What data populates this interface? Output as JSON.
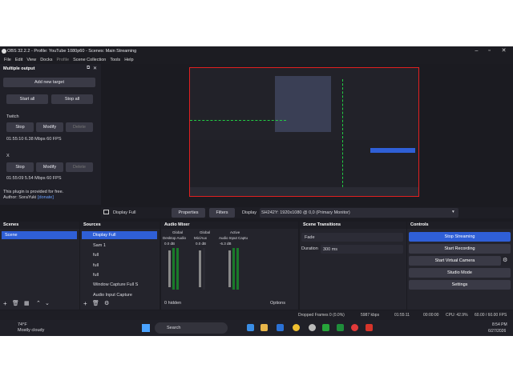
{
  "window": {
    "title": "OBS 32.2.2 - Profile: YouTube 1080p60 - Scenes: Main Streaming"
  },
  "menu": [
    "File",
    "Edit",
    "View",
    "Docks",
    "Profile",
    "Scene Collection",
    "Tools",
    "Help"
  ],
  "multi_output": {
    "title": "Multiple output",
    "add_target": "Add new target",
    "start_all": "Start all",
    "stop_all": "Stop all",
    "targets": [
      {
        "name": "Twitch",
        "stop": "Stop",
        "modify": "Modify",
        "delete": "Delete",
        "stats": "01:55:10  6.38 Mbps  60 FPS"
      },
      {
        "name": "X",
        "stop": "Stop",
        "modify": "Modify",
        "delete": "Delete",
        "stats": "01:55:09  5.54 Mbps  60 FPS"
      }
    ],
    "footer1": "This plugin is provided for free.",
    "footer2": "Author: SoraYuki",
    "footer_link": "[donate]"
  },
  "preview_bar": {
    "source": "Display Full",
    "properties": "Properties",
    "filters": "Filters",
    "display_label": "Display",
    "display_value": "SH242Y: 1920x1080 @ 0,0 (Primary Monitor)"
  },
  "scenes": {
    "title": "Scenes",
    "items": [
      "Scene"
    ]
  },
  "sources": {
    "title": "Sources",
    "items": [
      "Display Full",
      "Sam 1",
      "full",
      "full",
      "full",
      "Window Capture Full S",
      "Audio Input Capture"
    ]
  },
  "mixer": {
    "title": "Audio Mixer",
    "channels": [
      {
        "tag": "Global",
        "name": "Desktop Audio",
        "db": "0.0 dB"
      },
      {
        "tag": "Global",
        "name": "Mic/Aux",
        "db": "0.0 dB"
      },
      {
        "tag": "Active",
        "name": "Audio Input Capture",
        "db": "-6.3 dB"
      }
    ],
    "hidden": "0 hidden",
    "options": "Options"
  },
  "transitions": {
    "title": "Scene Transitions",
    "type": "Fade",
    "duration_label": "Duration",
    "duration": "300 ms"
  },
  "controls": {
    "title": "Controls",
    "buttons": [
      "Stop Streaming",
      "Start Recording",
      "Start Virtual Camera",
      "Studio Mode",
      "Settings"
    ]
  },
  "status": {
    "dropped": "Dropped Frames 0 (0.0%)",
    "kbps": "5987 kbps",
    "stream_time": "01:55:11",
    "rec_time": "00:00:00",
    "cpu": "CPU: 42.9%",
    "fps": "60.00 / 60.00 FPS"
  },
  "taskbar": {
    "temp": "74°F",
    "weather": "Mostly cloudy",
    "search": "Search",
    "time": "8:54 PM",
    "date": "6/27/2026"
  },
  "colors": {
    "accent": "#2f5fd6",
    "preview_border": "#e02020",
    "guides": "#22cc44"
  }
}
